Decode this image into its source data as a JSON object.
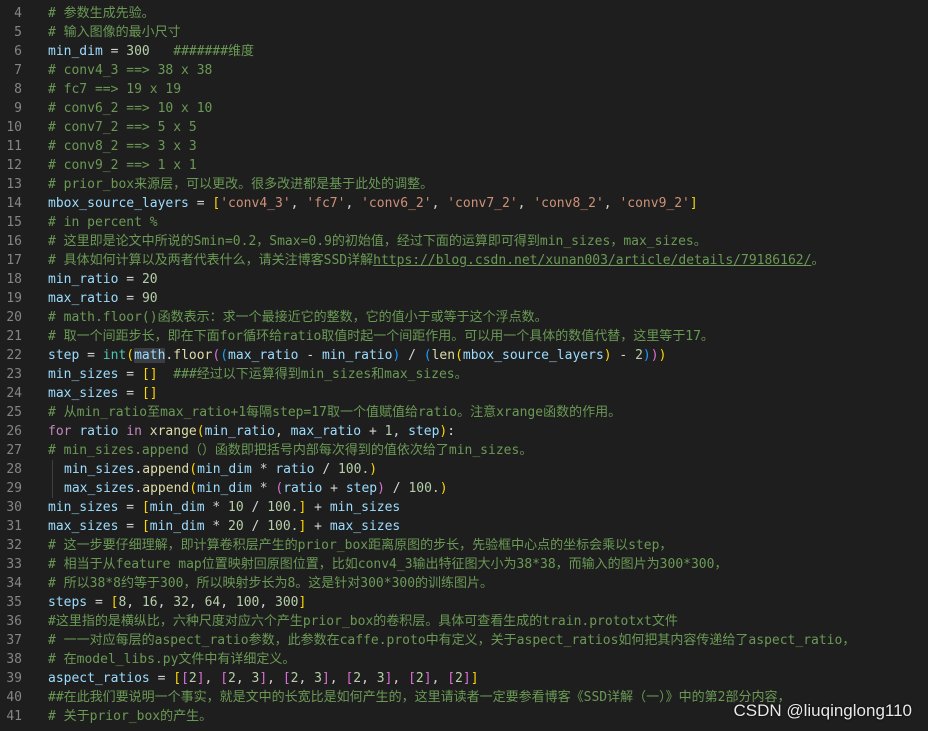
{
  "lines": [
    {
      "n": "4",
      "tokens": [
        [
          "c",
          "# 参数生成先验。"
        ]
      ]
    },
    {
      "n": "5",
      "tokens": [
        [
          "c",
          "# 输入图像的最小尺寸"
        ]
      ]
    },
    {
      "n": "6",
      "tokens": [
        [
          "v",
          "min_dim"
        ],
        [
          "o",
          " = "
        ],
        [
          "num",
          "300"
        ],
        [
          "o",
          "   "
        ],
        [
          "c",
          "#######维度"
        ]
      ]
    },
    {
      "n": "7",
      "tokens": [
        [
          "c",
          "# conv4_3 ==> 38 x 38"
        ]
      ]
    },
    {
      "n": "8",
      "tokens": [
        [
          "c",
          "# fc7 ==> 19 x 19"
        ]
      ]
    },
    {
      "n": "9",
      "tokens": [
        [
          "c",
          "# conv6_2 ==> 10 x 10"
        ]
      ]
    },
    {
      "n": "10",
      "tokens": [
        [
          "c",
          "# conv7_2 ==> 5 x 5"
        ]
      ]
    },
    {
      "n": "11",
      "tokens": [
        [
          "c",
          "# conv8_2 ==> 3 x 3"
        ]
      ]
    },
    {
      "n": "12",
      "tokens": [
        [
          "c",
          "# conv9_2 ==> 1 x 1"
        ]
      ]
    },
    {
      "n": "13",
      "tokens": [
        [
          "c",
          "# prior_box来源层，可以更改。很多改进都是基于此处的调整。"
        ]
      ]
    },
    {
      "n": "14",
      "tokens": [
        [
          "v",
          "mbox_source_layers"
        ],
        [
          "o",
          " = "
        ],
        [
          "b1",
          "["
        ],
        [
          "s",
          "'conv4_3'"
        ],
        [
          "o",
          ", "
        ],
        [
          "s",
          "'fc7'"
        ],
        [
          "o",
          ", "
        ],
        [
          "s",
          "'conv6_2'"
        ],
        [
          "o",
          ", "
        ],
        [
          "s",
          "'conv7_2'"
        ],
        [
          "o",
          ", "
        ],
        [
          "s",
          "'conv8_2'"
        ],
        [
          "o",
          ", "
        ],
        [
          "s",
          "'conv9_2'"
        ],
        [
          "b1",
          "]"
        ]
      ]
    },
    {
      "n": "15",
      "tokens": [
        [
          "c",
          "# in percent %"
        ]
      ]
    },
    {
      "n": "16",
      "tokens": [
        [
          "c",
          "# 这里即是论文中所说的Smin=0.2，Smax=0.9的初始值，经过下面的运算即可得到min_sizes，max_sizes。"
        ]
      ]
    },
    {
      "n": "17",
      "tokens": [
        [
          "c",
          "# 具体如何计算以及两者代表什么，请关注博客SSD详解"
        ],
        [
          "lnk",
          "https://blog.csdn.net/xunan003/article/details/79186162/"
        ],
        [
          "c",
          "。"
        ]
      ]
    },
    {
      "n": "18",
      "tokens": [
        [
          "v",
          "min_ratio"
        ],
        [
          "o",
          " = "
        ],
        [
          "num",
          "20"
        ]
      ]
    },
    {
      "n": "19",
      "tokens": [
        [
          "v",
          "max_ratio"
        ],
        [
          "o",
          " = "
        ],
        [
          "num",
          "90"
        ]
      ]
    },
    {
      "n": "20",
      "tokens": [
        [
          "c",
          "# math.floor()函数表示：求一个最接近它的整数，它的值小于或等于这个浮点数。"
        ]
      ]
    },
    {
      "n": "21",
      "tokens": [
        [
          "c",
          "# 取一个间距步长，即在下面for循环给ratio取值时起一个间距作用。可以用一个具体的数值代替，这里等于17。"
        ]
      ]
    },
    {
      "n": "22",
      "tokens": [
        [
          "v",
          "step"
        ],
        [
          "o",
          " = "
        ],
        [
          "cls",
          "int"
        ],
        [
          "b1",
          "("
        ],
        [
          "hl",
          "math"
        ],
        [
          "o",
          "."
        ],
        [
          "f",
          "floor"
        ],
        [
          "b2",
          "("
        ],
        [
          "b3",
          "("
        ],
        [
          "v",
          "max_ratio"
        ],
        [
          "o",
          " - "
        ],
        [
          "v",
          "min_ratio"
        ],
        [
          "b3",
          ")"
        ],
        [
          "o",
          " / "
        ],
        [
          "b3",
          "("
        ],
        [
          "f",
          "len"
        ],
        [
          "b1",
          "("
        ],
        [
          "v",
          "mbox_source_layers"
        ],
        [
          "b1",
          ")"
        ],
        [
          "o",
          " - "
        ],
        [
          "num",
          "2"
        ],
        [
          "b3",
          ")"
        ],
        [
          "b2",
          ")"
        ],
        [
          "b1",
          ")"
        ]
      ]
    },
    {
      "n": "23",
      "tokens": [
        [
          "v",
          "min_sizes"
        ],
        [
          "o",
          " = "
        ],
        [
          "b1",
          "[]"
        ],
        [
          "o",
          "  "
        ],
        [
          "c",
          "###经过以下运算得到min_sizes和max_sizes。"
        ]
      ]
    },
    {
      "n": "24",
      "tokens": [
        [
          "v",
          "max_sizes"
        ],
        [
          "o",
          " = "
        ],
        [
          "b1",
          "[]"
        ]
      ]
    },
    {
      "n": "25",
      "tokens": [
        [
          "c",
          "# 从min_ratio至max_ratio+1每隔step=17取一个值赋值给ratio。注意xrange函数的作用。"
        ]
      ]
    },
    {
      "n": "26",
      "tokens": [
        [
          "k",
          "for"
        ],
        [
          "o",
          " "
        ],
        [
          "v",
          "ratio"
        ],
        [
          "o",
          " "
        ],
        [
          "k",
          "in"
        ],
        [
          "o",
          " "
        ],
        [
          "f",
          "xrange"
        ],
        [
          "b1",
          "("
        ],
        [
          "v",
          "min_ratio"
        ],
        [
          "o",
          ", "
        ],
        [
          "v",
          "max_ratio"
        ],
        [
          "o",
          " + "
        ],
        [
          "num",
          "1"
        ],
        [
          "o",
          ", "
        ],
        [
          "v",
          "step"
        ],
        [
          "b1",
          ")"
        ],
        [
          "o",
          ":"
        ]
      ]
    },
    {
      "n": "27",
      "tokens": [
        [
          "c",
          "# min_sizes.append（）函数即把括号内部每次得到的值依次给了min_sizes。"
        ]
      ]
    },
    {
      "n": "28",
      "indent": true,
      "tokens": [
        [
          "v",
          "min_sizes"
        ],
        [
          "o",
          "."
        ],
        [
          "f",
          "append"
        ],
        [
          "b1",
          "("
        ],
        [
          "v",
          "min_dim"
        ],
        [
          "o",
          " * "
        ],
        [
          "v",
          "ratio"
        ],
        [
          "o",
          " / "
        ],
        [
          "num",
          "100."
        ],
        [
          "b1",
          ")"
        ]
      ]
    },
    {
      "n": "29",
      "indent": true,
      "tokens": [
        [
          "v",
          "max_sizes"
        ],
        [
          "o",
          "."
        ],
        [
          "f",
          "append"
        ],
        [
          "b1",
          "("
        ],
        [
          "v",
          "min_dim"
        ],
        [
          "o",
          " * "
        ],
        [
          "b2",
          "("
        ],
        [
          "v",
          "ratio"
        ],
        [
          "o",
          " + "
        ],
        [
          "v",
          "step"
        ],
        [
          "b2",
          ")"
        ],
        [
          "o",
          " / "
        ],
        [
          "num",
          "100."
        ],
        [
          "b1",
          ")"
        ]
      ]
    },
    {
      "n": "30",
      "tokens": [
        [
          "v",
          "min_sizes"
        ],
        [
          "o",
          " = "
        ],
        [
          "b1",
          "["
        ],
        [
          "v",
          "min_dim"
        ],
        [
          "o",
          " * "
        ],
        [
          "num",
          "10"
        ],
        [
          "o",
          " / "
        ],
        [
          "num",
          "100."
        ],
        [
          "b1",
          "]"
        ],
        [
          "o",
          " + "
        ],
        [
          "v",
          "min_sizes"
        ]
      ]
    },
    {
      "n": "31",
      "tokens": [
        [
          "v",
          "max_sizes"
        ],
        [
          "o",
          " = "
        ],
        [
          "b1",
          "["
        ],
        [
          "v",
          "min_dim"
        ],
        [
          "o",
          " * "
        ],
        [
          "num",
          "20"
        ],
        [
          "o",
          " / "
        ],
        [
          "num",
          "100."
        ],
        [
          "b1",
          "]"
        ],
        [
          "o",
          " + "
        ],
        [
          "v",
          "max_sizes"
        ]
      ]
    },
    {
      "n": "32",
      "tokens": [
        [
          "c",
          "# 这一步要仔细理解，即计算卷积层产生的prior_box距离原图的步长，先验框中心点的坐标会乘以step，"
        ]
      ]
    },
    {
      "n": "33",
      "tokens": [
        [
          "c",
          "# 相当于从feature map位置映射回原图位置，比如conv4_3输出特征图大小为38*38，而输入的图片为300*300，"
        ]
      ]
    },
    {
      "n": "34",
      "tokens": [
        [
          "c",
          "# 所以38*8约等于300，所以映射步长为8。这是针对300*300的训练图片。"
        ]
      ]
    },
    {
      "n": "35",
      "tokens": [
        [
          "v",
          "steps"
        ],
        [
          "o",
          " = "
        ],
        [
          "b1",
          "["
        ],
        [
          "num",
          "8"
        ],
        [
          "o",
          ", "
        ],
        [
          "num",
          "16"
        ],
        [
          "o",
          ", "
        ],
        [
          "num",
          "32"
        ],
        [
          "o",
          ", "
        ],
        [
          "num",
          "64"
        ],
        [
          "o",
          ", "
        ],
        [
          "num",
          "100"
        ],
        [
          "o",
          ", "
        ],
        [
          "num",
          "300"
        ],
        [
          "b1",
          "]"
        ]
      ]
    },
    {
      "n": "36",
      "tokens": [
        [
          "c",
          "#这里指的是横纵比，六种尺度对应六个产生prior_box的卷积层。具体可查看生成的train.prototxt文件"
        ]
      ]
    },
    {
      "n": "37",
      "tokens": [
        [
          "c",
          "# 一一对应每层的aspect_ratio参数，此参数在caffe.proto中有定义，关于aspect_ratios如何把其内容传递给了aspect_ratio，"
        ]
      ]
    },
    {
      "n": "38",
      "tokens": [
        [
          "c",
          "# 在model_libs.py文件中有详细定义。"
        ]
      ]
    },
    {
      "n": "39",
      "tokens": [
        [
          "v",
          "aspect_ratios"
        ],
        [
          "o",
          " = "
        ],
        [
          "b1",
          "["
        ],
        [
          "b2",
          "["
        ],
        [
          "num",
          "2"
        ],
        [
          "b2",
          "]"
        ],
        [
          "o",
          ", "
        ],
        [
          "b2",
          "["
        ],
        [
          "num",
          "2"
        ],
        [
          "o",
          ", "
        ],
        [
          "num",
          "3"
        ],
        [
          "b2",
          "]"
        ],
        [
          "o",
          ", "
        ],
        [
          "b2",
          "["
        ],
        [
          "num",
          "2"
        ],
        [
          "o",
          ", "
        ],
        [
          "num",
          "3"
        ],
        [
          "b2",
          "]"
        ],
        [
          "o",
          ", "
        ],
        [
          "b2",
          "["
        ],
        [
          "num",
          "2"
        ],
        [
          "o",
          ", "
        ],
        [
          "num",
          "3"
        ],
        [
          "b2",
          "]"
        ],
        [
          "o",
          ", "
        ],
        [
          "b2",
          "["
        ],
        [
          "num",
          "2"
        ],
        [
          "b2",
          "]"
        ],
        [
          "o",
          ", "
        ],
        [
          "b2",
          "["
        ],
        [
          "num",
          "2"
        ],
        [
          "b2",
          "]"
        ],
        [
          "b1",
          "]"
        ]
      ]
    },
    {
      "n": "40",
      "tokens": [
        [
          "c",
          "##在此我们要说明一个事实，就是文中的长宽比是如何产生的，这里请读者一定要参看博客《SSD详解（一）》中的第2部分内容，"
        ]
      ]
    },
    {
      "n": "41",
      "tokens": [
        [
          "c",
          "# 关于prior_box的产生。"
        ]
      ]
    }
  ],
  "watermark": "CSDN @liuqinglong110",
  "colors": {
    "background": "#1e1e1e",
    "line_number": "#858585",
    "comment": "#6a9955",
    "variable": "#9cdcfe",
    "number": "#b5cea8",
    "string": "#ce9178",
    "keyword": "#c586c0",
    "function": "#dcdcaa",
    "class": "#4ec9b0",
    "bracket_1": "#ffd700",
    "bracket_2": "#da70d6",
    "bracket_3": "#179fff"
  }
}
